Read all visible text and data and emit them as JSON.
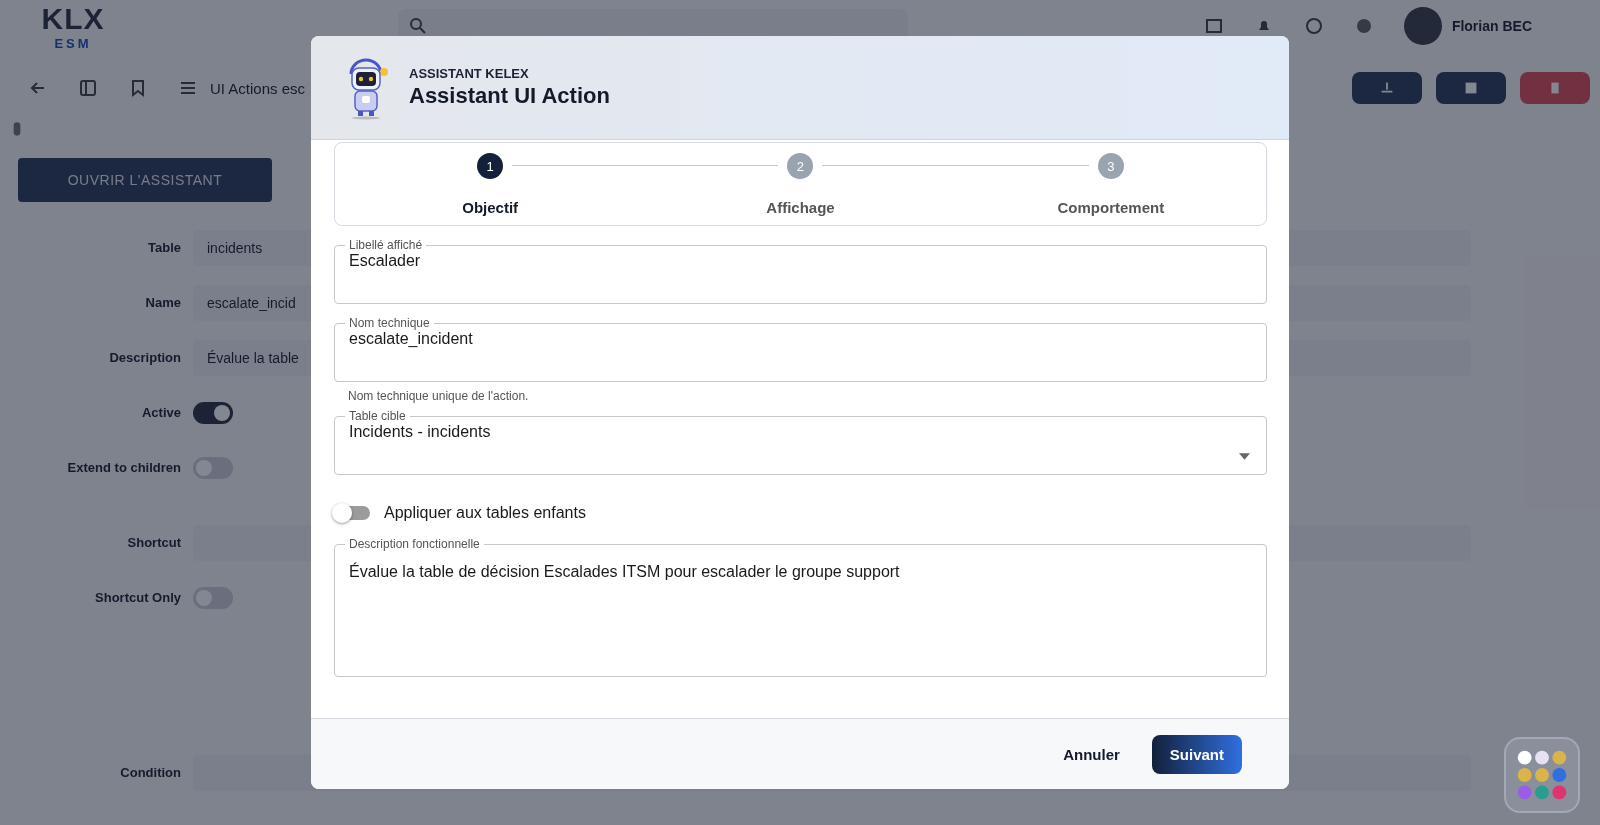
{
  "app_header": {
    "logo": {
      "text": "KLX",
      "subtitle": "ESM"
    },
    "user": {
      "name": "Florian BEC"
    }
  },
  "toolbar": {
    "breadcrumb": "UI Actions esc"
  },
  "assistant_button": {
    "label": "OUVRIR L'ASSISTANT"
  },
  "form_rows": [
    {
      "label": "Table",
      "kind": "text",
      "value": "incidents"
    },
    {
      "label": "Name",
      "kind": "text",
      "value": "escalate_incid"
    },
    {
      "label": "Description",
      "kind": "select",
      "value": "Évalue la table"
    },
    {
      "label": "Active",
      "kind": "toggle",
      "on": true
    },
    {
      "label": "Extend to children",
      "kind": "toggle",
      "on": false
    },
    {
      "label": "Shortcut",
      "kind": "text"
    },
    {
      "label": "Shortcut Only",
      "kind": "toggle",
      "on": false
    }
  ],
  "condition_row": {
    "label": "Condition"
  },
  "dialog": {
    "eyebrow": "ASSISTANT KELEX",
    "title": "Assistant UI Action",
    "steps": [
      {
        "number": "1",
        "label": "Objectif",
        "selected": true
      },
      {
        "number": "2",
        "label": "Affichage",
        "selected": false
      },
      {
        "number": "3",
        "label": "Comportement",
        "selected": false
      }
    ],
    "fields": [
      {
        "kind": "text",
        "label": "Libellé affiché",
        "value": "Escalader"
      },
      {
        "kind": "text",
        "label": "Nom technique",
        "value": "escalate_incident",
        "hint": "Nom technique unique de l'action."
      },
      {
        "kind": "select",
        "label": "Table cible",
        "value": "Incidents - incidents"
      },
      {
        "kind": "toggle",
        "label": "Appliquer aux tables enfants",
        "on": false
      },
      {
        "kind": "textarea",
        "label": "Description fonctionnelle",
        "value": "Évalue la table de décision Escalades ITSM pour escalader le groupe support"
      }
    ],
    "buttons": [
      {
        "kind": "text",
        "label": "Annuler"
      },
      {
        "kind": "primary",
        "label": "Suivant"
      }
    ]
  }
}
